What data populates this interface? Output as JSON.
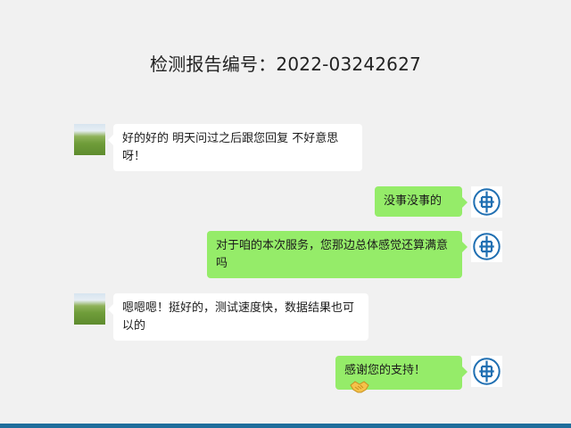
{
  "header": {
    "title": "检测报告编号：2022-03242627"
  },
  "chat": {
    "messages": [
      {
        "sender": "customer",
        "text": "好的好的 明天问过之后跟您回复 不好意思呀！"
      },
      {
        "sender": "agent",
        "text": "没事没事的"
      },
      {
        "sender": "agent",
        "text": "对于咱的本次服务，您那边总体感觉还算满意吗"
      },
      {
        "sender": "customer",
        "text": "嗯嗯嗯！挺好的，测试速度快，数据结果也可以的"
      },
      {
        "sender": "agent",
        "text": "感谢您的支持！",
        "emoji": "handshake-icon"
      }
    ]
  },
  "colors": {
    "background": "#f1f1f1",
    "outgoing_bubble": "#95ec69",
    "incoming_bubble": "#ffffff",
    "logo_blue": "#1f6fb2",
    "footer_bar": "#1f6e9c"
  }
}
